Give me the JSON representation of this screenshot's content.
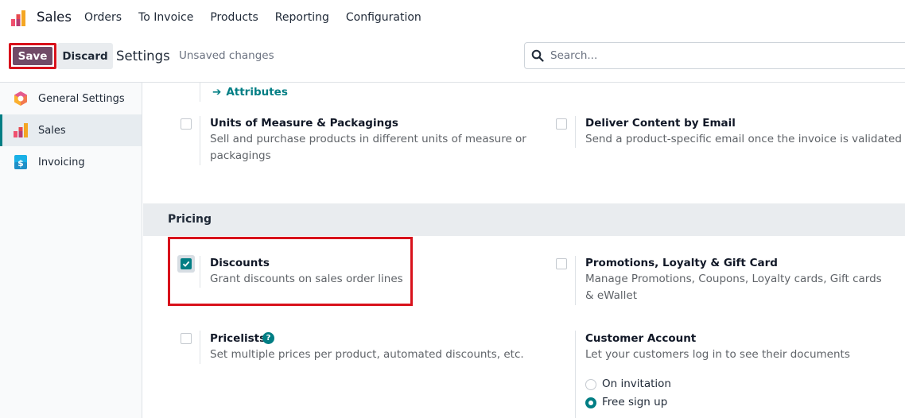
{
  "navbar": {
    "app_name": "Sales",
    "menu": [
      "Orders",
      "To Invoice",
      "Products",
      "Reporting",
      "Configuration"
    ]
  },
  "control_panel": {
    "save_label": "Save",
    "discard_label": "Discard",
    "title": "Settings",
    "status": "Unsaved changes",
    "search_placeholder": "Search..."
  },
  "sidebar": {
    "items": [
      {
        "label": "General Settings",
        "icon": "odoo-hexagon-icon",
        "active": false
      },
      {
        "label": "Sales",
        "icon": "sales-bars-icon",
        "active": true
      },
      {
        "label": "Invoicing",
        "icon": "invoicing-icon",
        "active": false
      }
    ]
  },
  "products_section": {
    "attributes_link": "Attributes",
    "uom": {
      "title": "Units of Measure & Packagings",
      "desc": "Sell and purchase products in different units of measure or packagings",
      "checked": false
    },
    "deliver_email": {
      "title": "Deliver Content by Email",
      "desc": "Send a product-specific email once the invoice is validated",
      "checked": false
    }
  },
  "pricing_section": {
    "title": "Pricing",
    "discounts": {
      "title": "Discounts",
      "desc": "Grant discounts on sales order lines",
      "checked": true
    },
    "promotions": {
      "title": "Promotions, Loyalty & Gift Card",
      "desc": "Manage Promotions, Coupons, Loyalty cards, Gift cards & eWallet",
      "checked": false
    },
    "pricelists": {
      "title": "Pricelists",
      "desc": "Set multiple prices per product, automated discounts, etc.",
      "checked": false,
      "help": "?"
    },
    "customer_account": {
      "title": "Customer Account",
      "desc": "Let your customers log in to see their documents",
      "options": [
        {
          "label": "On invitation",
          "selected": false
        },
        {
          "label": "Free sign up",
          "selected": true
        }
      ]
    }
  },
  "colors": {
    "brand": "#714b67",
    "accent": "#017e84",
    "highlight": "#d8111b"
  }
}
